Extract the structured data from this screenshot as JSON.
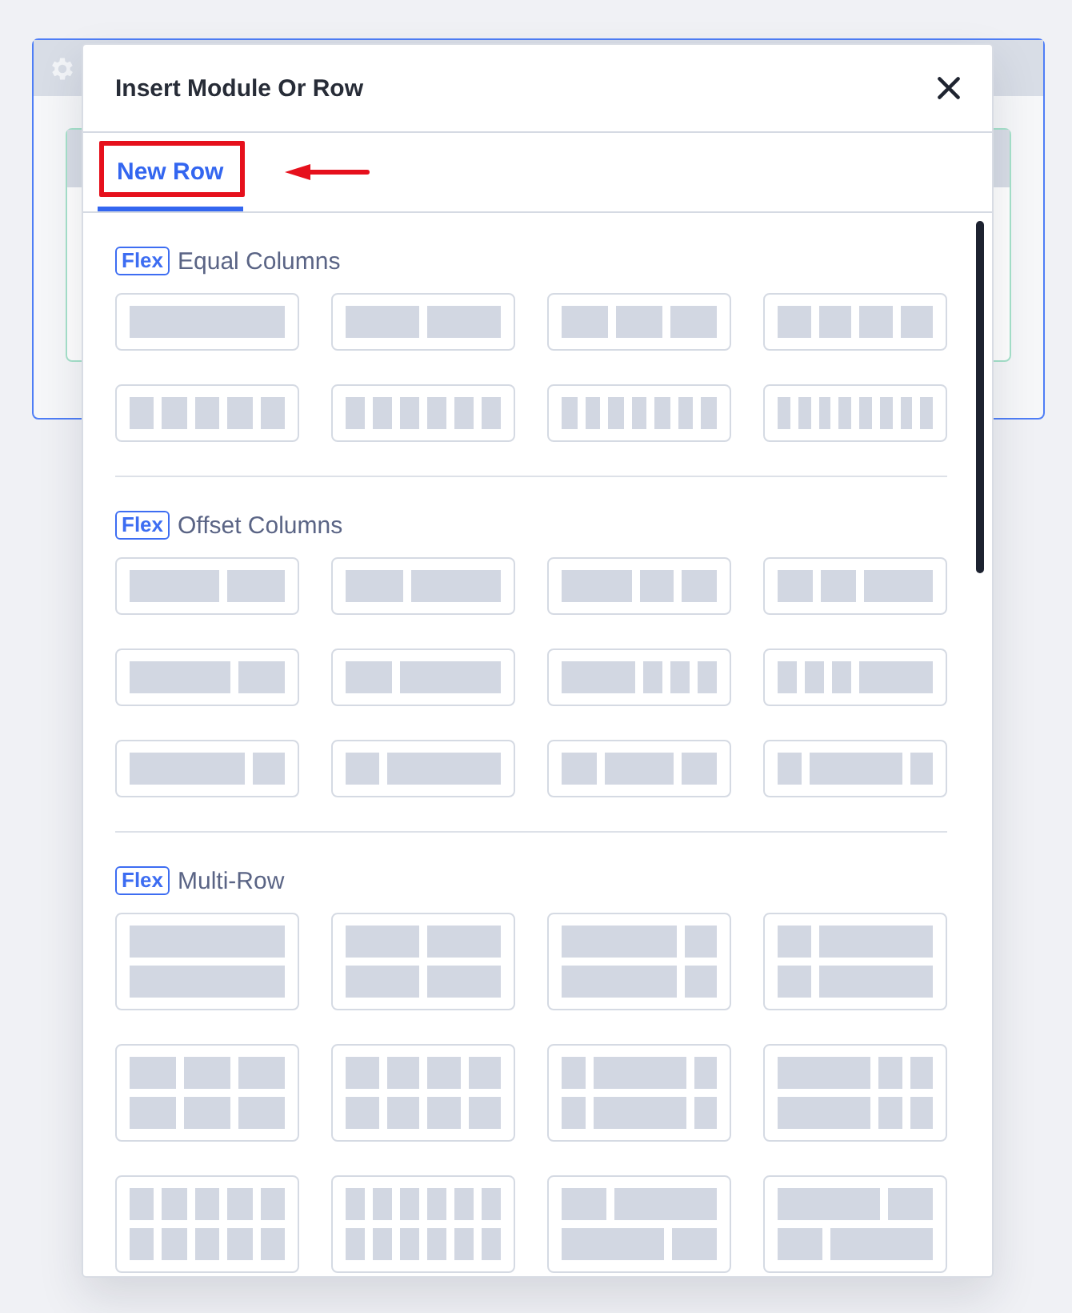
{
  "dialog": {
    "title": "Insert Module Or Row"
  },
  "tabs": [
    {
      "label": "New Row",
      "selected": true,
      "highlighted": true,
      "arrow": true
    }
  ],
  "sections": [
    {
      "badge": "Flex",
      "title": "Equal Columns",
      "layouts": [
        {
          "kind": "one"
        },
        {
          "kind": "two"
        },
        {
          "kind": "three"
        },
        {
          "kind": "four"
        },
        {
          "kind": "five"
        },
        {
          "kind": "six"
        },
        {
          "kind": "seven"
        },
        {
          "kind": "eight"
        }
      ]
    },
    {
      "badge": "Flex",
      "title": "Offset Columns",
      "layouts": [
        {
          "kind": "sixty-forty"
        },
        {
          "kind": "forty-sixty"
        },
        {
          "kind": "half-quarters"
        },
        {
          "kind": "quarters-half"
        },
        {
          "kind": "seventy-thirty"
        },
        {
          "kind": "thirty-seventy"
        },
        {
          "kind": "half-sixths"
        },
        {
          "kind": "sixths-half"
        },
        {
          "kind": "eighty-twenty"
        },
        {
          "kind": "twenty-eighty"
        },
        {
          "kind": "quarter-half-quarter"
        },
        {
          "kind": "sixth-wide-sixth"
        }
      ]
    },
    {
      "badge": "Flex",
      "title": "Multi-Row",
      "layouts": [
        {
          "kind": "stack-one"
        },
        {
          "kind": "stack-two"
        },
        {
          "kind": "stack-wide-left"
        },
        {
          "kind": "stack-wide-right"
        },
        {
          "kind": "stack-three"
        },
        {
          "kind": "stack-four"
        },
        {
          "kind": "stack-wide-center"
        },
        {
          "kind": "stack-wide-first"
        },
        {
          "kind": "stack-five"
        },
        {
          "kind": "stack-six"
        },
        {
          "kind": "stack-stagger-left"
        },
        {
          "kind": "stack-stagger-right"
        }
      ]
    }
  ]
}
